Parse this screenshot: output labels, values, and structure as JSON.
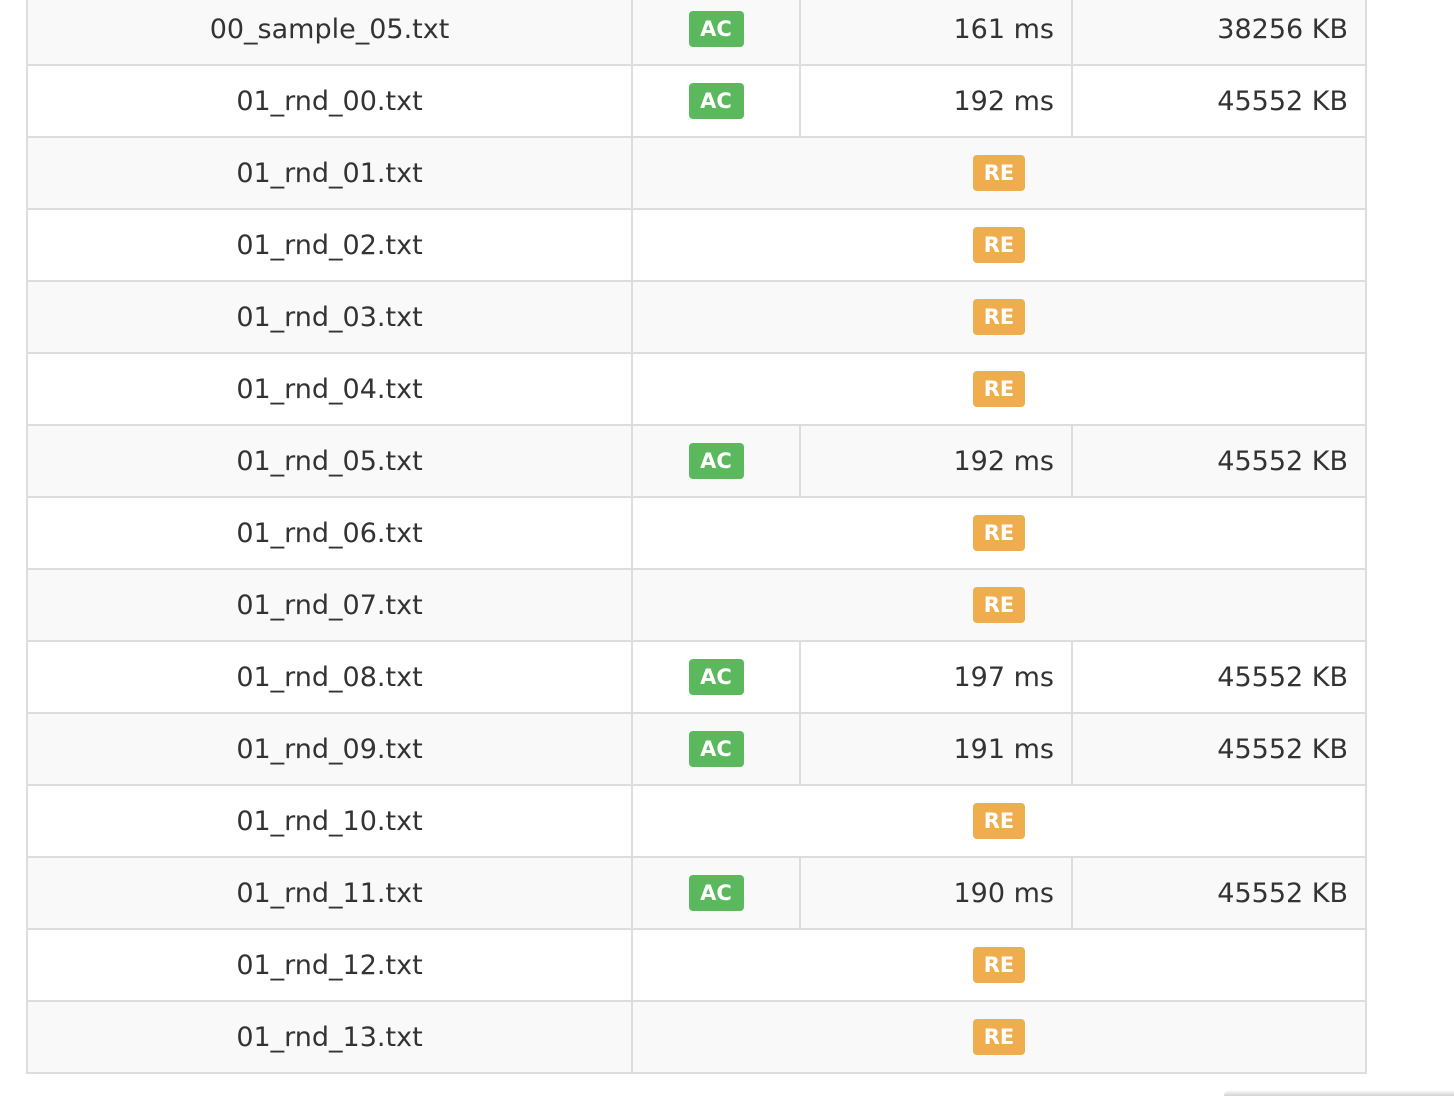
{
  "rows": [
    {
      "case": "00_sample_05.txt",
      "status": "AC",
      "time": "161 ms",
      "memory": "38256 KB"
    },
    {
      "case": "01_rnd_00.txt",
      "status": "AC",
      "time": "192 ms",
      "memory": "45552 KB"
    },
    {
      "case": "01_rnd_01.txt",
      "status": "RE"
    },
    {
      "case": "01_rnd_02.txt",
      "status": "RE"
    },
    {
      "case": "01_rnd_03.txt",
      "status": "RE"
    },
    {
      "case": "01_rnd_04.txt",
      "status": "RE"
    },
    {
      "case": "01_rnd_05.txt",
      "status": "AC",
      "time": "192 ms",
      "memory": "45552 KB"
    },
    {
      "case": "01_rnd_06.txt",
      "status": "RE"
    },
    {
      "case": "01_rnd_07.txt",
      "status": "RE"
    },
    {
      "case": "01_rnd_08.txt",
      "status": "AC",
      "time": "197 ms",
      "memory": "45552 KB"
    },
    {
      "case": "01_rnd_09.txt",
      "status": "AC",
      "time": "191 ms",
      "memory": "45552 KB"
    },
    {
      "case": "01_rnd_10.txt",
      "status": "RE"
    },
    {
      "case": "01_rnd_11.txt",
      "status": "AC",
      "time": "190 ms",
      "memory": "45552 KB"
    },
    {
      "case": "01_rnd_12.txt",
      "status": "RE"
    },
    {
      "case": "01_rnd_13.txt",
      "status": "RE"
    }
  ],
  "colors": {
    "ac": "#5cb85c",
    "re": "#f0ad4e",
    "border": "#dddddd",
    "row_stripe": "#f9f9f9",
    "text": "#333333"
  }
}
